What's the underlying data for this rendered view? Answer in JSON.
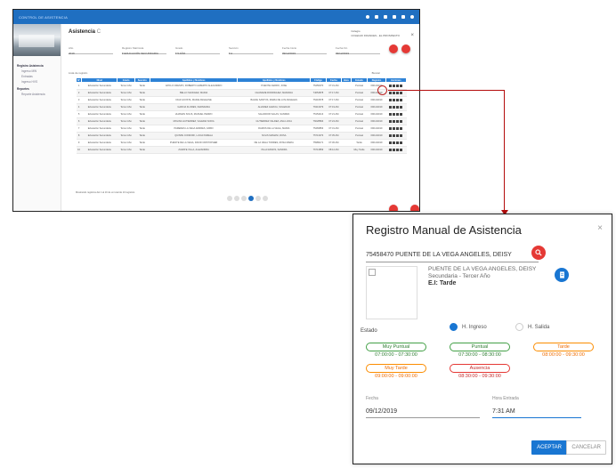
{
  "background_app": {
    "topbar_title": "CONTROL DE ASISTENCIA",
    "sidebar": {
      "items": [
        {
          "label": "Registro Asistencia",
          "type": "sec"
        },
        {
          "label": "Ingreso MW",
          "type": "sub"
        },
        {
          "label": "Entradas",
          "type": "sub"
        },
        {
          "label": "Ingreso HVS",
          "type": "sub"
        },
        {
          "label": "Reportes",
          "type": "sec"
        },
        {
          "label": "Reporte Asistencia",
          "type": "sub"
        }
      ]
    },
    "page_title": "Asistencia",
    "page_title_suffix": "C",
    "school_label": "Colegio",
    "school_value": "COLEGIO FRANCES - EL PROSPECTO",
    "filters": [
      {
        "label": "Año",
        "value": "2019"
      },
      {
        "label": "Registro Matrícula",
        "value": "▾ EDUCACIÓN SECUNDARIA"
      },
      {
        "label": "Grado",
        "value": "▾ 5 AÑO"
      },
      {
        "label": "Sección",
        "value": "▾ A"
      },
      {
        "label": "Fecha Inicio",
        "value": "09/12/2019"
      },
      {
        "label": "Fecha Fin",
        "value": "09/12/2019"
      }
    ],
    "table_caption": "Lista de  registro",
    "table_search": "Buscar",
    "columns": [
      "N°",
      "Nivel",
      "Grado",
      "Sección",
      "Apellidos y Nombres",
      "Apellidos y Nombres",
      "Código",
      "Fecha",
      "Hora",
      "Estado",
      "Registro",
      "Acciones"
    ],
    "rows": [
      [
        "1",
        "Educación Secundaria",
        "Tercer Año",
        "Tarde",
        "APOLO CRESPO, ROBERTO ALBERTO ALEJANDRO",
        "PUENTE CERRO, JOSE",
        "75456070",
        "07:31 AM",
        "Puntual",
        "09/12/2019"
      ],
      [
        "2",
        "Educación Secundaria",
        "Tercer Año",
        "Tarde",
        "BELLO SANCHEZ, MARIA",
        "CHANAME RODRIGUEZ, MARIANA",
        "74654878",
        "07:17 AM",
        "Puntual",
        "09/12/2019"
      ],
      [
        "3",
        "Educación Secundaria",
        "Tercer Año",
        "Tarde",
        "DIAZ ACOSTA, MARIA ANGELINE",
        "BALDE SANTOS, MARIA DE LOS ANGELES",
        "75419578",
        "07:17 AM",
        "Puntual",
        "09/12/2019"
      ],
      [
        "4",
        "Educación Secundaria",
        "Tercer Año",
        "Tarde",
        "GARCIA FLORES, FERNANDA",
        "ALVAREZ GARCIA, SOLEDAD",
        "76313079",
        "07:19 AM",
        "Puntual",
        "09/12/2019"
      ],
      [
        "5",
        "Educación Secundaria",
        "Tercer Año",
        "Tarde",
        "HUAMAN SOLIS, MANUEL PEDRO",
        "SALVADOR SALAS, SANDRA",
        "75154413",
        "07:21 AM",
        "Puntual",
        "09/12/2019"
      ],
      [
        "6",
        "Educación Secundaria",
        "Tercer Año",
        "Tarde",
        "MOLINA GUTIERREZ, VALERIA SOFIA",
        "GUTIERREZ VALDEZ, ANA LUCIA",
        "76028893",
        "07:24 AM",
        "Puntual",
        "09/12/2019"
      ],
      [
        "7",
        "Educación Secundaria",
        "Tercer Año",
        "Tarde",
        "PAREDES LA VEGA ANDRES, FABIO",
        "RAMOS DE LA VEGA, MARIA",
        "75469853",
        "07:31 AM",
        "Puntual",
        "09/12/2019"
      ],
      [
        "8",
        "Educación Secundaria",
        "Tercer Año",
        "Tarde",
        "QUISPE CONDORI, LUCIA PAMELA",
        "SOLIS MAMANI, ROSA",
        "75713073",
        "07:35 AM",
        "Puntual",
        "09/12/2019"
      ],
      [
        "9",
        "Educación Secundaria",
        "Tercer Año",
        "Tarde",
        "PUENTE DE LA VEGA, DAVID CRISTOPHER",
        "DE LA VEGA TORRES, ROSA MARIA",
        "75989171",
        "07:36 AM",
        "Tarde",
        "09/12/2019"
      ],
      [
        "10",
        "Educación Secundaria",
        "Tercer Año",
        "Tarde",
        "ZARATE VILLA, ALEJANDRA",
        "VILLA RAMOS, SANDRA",
        "76713859",
        "08:12 AM",
        "Muy Tarde",
        "09/12/2019"
      ]
    ],
    "footer_text": "Mostrando registros del 1 al 10 de un total de 10 registros",
    "pages": [
      "1",
      "2",
      "3",
      "4",
      "5",
      "6"
    ]
  },
  "dialog": {
    "title": "Registro Manual de Asistencia",
    "close_label": "×",
    "student_line": "75458470  PUENTE DE LA VEGA ANGELES, DEISY",
    "student_name": "PUENTE DE LA VEGA ANGELES, DEISY",
    "student_level": "Secundaria - Tercer Año",
    "student_shift": "E.I: Tarde",
    "estado_label": "Estado",
    "radio_ingreso": "H. Ingreso",
    "radio_salida": "H. Salida",
    "chips": [
      {
        "label": "Muy Puntual",
        "range": "07:00:00 - 07:30:00",
        "color": "green"
      },
      {
        "label": "Puntual",
        "range": "07:30:00 - 08:30:00",
        "color": "green"
      },
      {
        "label": "Tarde",
        "range": "08:00:00 - 09:30:00",
        "color": "orange"
      },
      {
        "label": "Muy Tarde",
        "range": "09:00:00 - 09:00:00",
        "color": "orange"
      },
      {
        "label": "Ausencia",
        "range": "08:30:00 - 09:30:00",
        "color": "red"
      }
    ],
    "fecha_label": "Fecha",
    "fecha_value": "09/12/2019",
    "hora_label": "Hora Entrada",
    "hora_value": "7:31 AM",
    "accept_label": "ACEPTAR",
    "cancel_label": "CANCELAR"
  },
  "colors": {
    "primary": "#1f6fc1",
    "accent_red": "#e53935",
    "arrow": "#b40c0c"
  }
}
